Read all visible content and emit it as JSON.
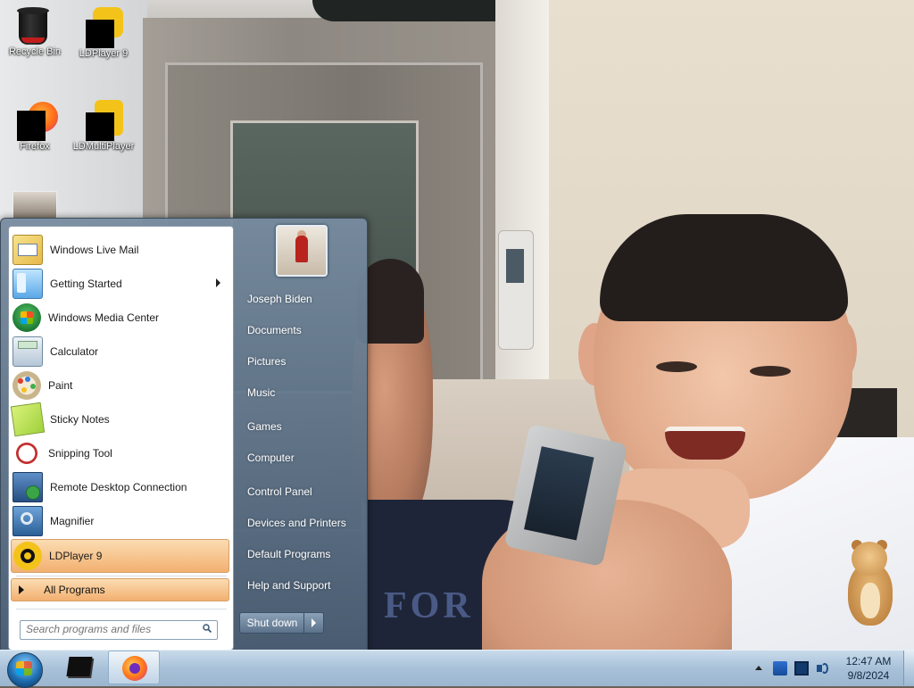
{
  "desktop": {
    "icons": [
      {
        "label": "Recycle Bin",
        "icon": "recycle-bin-icon"
      },
      {
        "label": "LDPlayer 9",
        "icon": "ldplayer-icon"
      },
      {
        "label": "Firefox",
        "icon": "firefox-icon"
      },
      {
        "label": "LDMultiPlayer",
        "icon": "ldmultiplayer-icon"
      }
    ],
    "wallpaper_text": "FOR"
  },
  "start_menu": {
    "programs": [
      {
        "label": "Windows Live Mail",
        "icon": "windows-live-mail-icon"
      },
      {
        "label": "Getting Started",
        "icon": "getting-started-icon",
        "has_submenu": true
      },
      {
        "label": "Windows Media Center",
        "icon": "windows-media-center-icon"
      },
      {
        "label": "Calculator",
        "icon": "calculator-icon"
      },
      {
        "label": "Paint",
        "icon": "paint-icon"
      },
      {
        "label": "Sticky Notes",
        "icon": "sticky-notes-icon"
      },
      {
        "label": "Snipping Tool",
        "icon": "snipping-tool-icon"
      },
      {
        "label": "Remote Desktop Connection",
        "icon": "remote-desktop-icon"
      },
      {
        "label": "Magnifier",
        "icon": "magnifier-icon"
      },
      {
        "label": "LDPlayer 9",
        "icon": "ldplayer-icon",
        "selected": true
      }
    ],
    "all_programs_label": "All Programs",
    "search_placeholder": "Search programs and files",
    "right_items": [
      {
        "label": "Joseph Biden"
      },
      {
        "label": "Documents"
      },
      {
        "label": "Pictures"
      },
      {
        "label": "Music"
      },
      {
        "label": "Games"
      },
      {
        "label": "Computer"
      },
      {
        "label": "Control Panel"
      },
      {
        "label": "Devices and Printers"
      },
      {
        "label": "Default Programs"
      },
      {
        "label": "Help and Support"
      }
    ],
    "shutdown_label": "Shut down"
  },
  "taskbar": {
    "pinned": [
      {
        "icon": "ldplayer-taskbar-icon"
      },
      {
        "icon": "firefox-taskbar-icon",
        "active": true
      }
    ],
    "tray_icons": [
      "action-center-icon",
      "network-icon",
      "volume-icon"
    ],
    "clock": {
      "time": "12:47 AM",
      "date": "9/8/2024"
    }
  },
  "colors": {
    "selection": "#f2b070",
    "menu_right_pane": "#5d7894",
    "taskbar": "#a8c1d8"
  }
}
